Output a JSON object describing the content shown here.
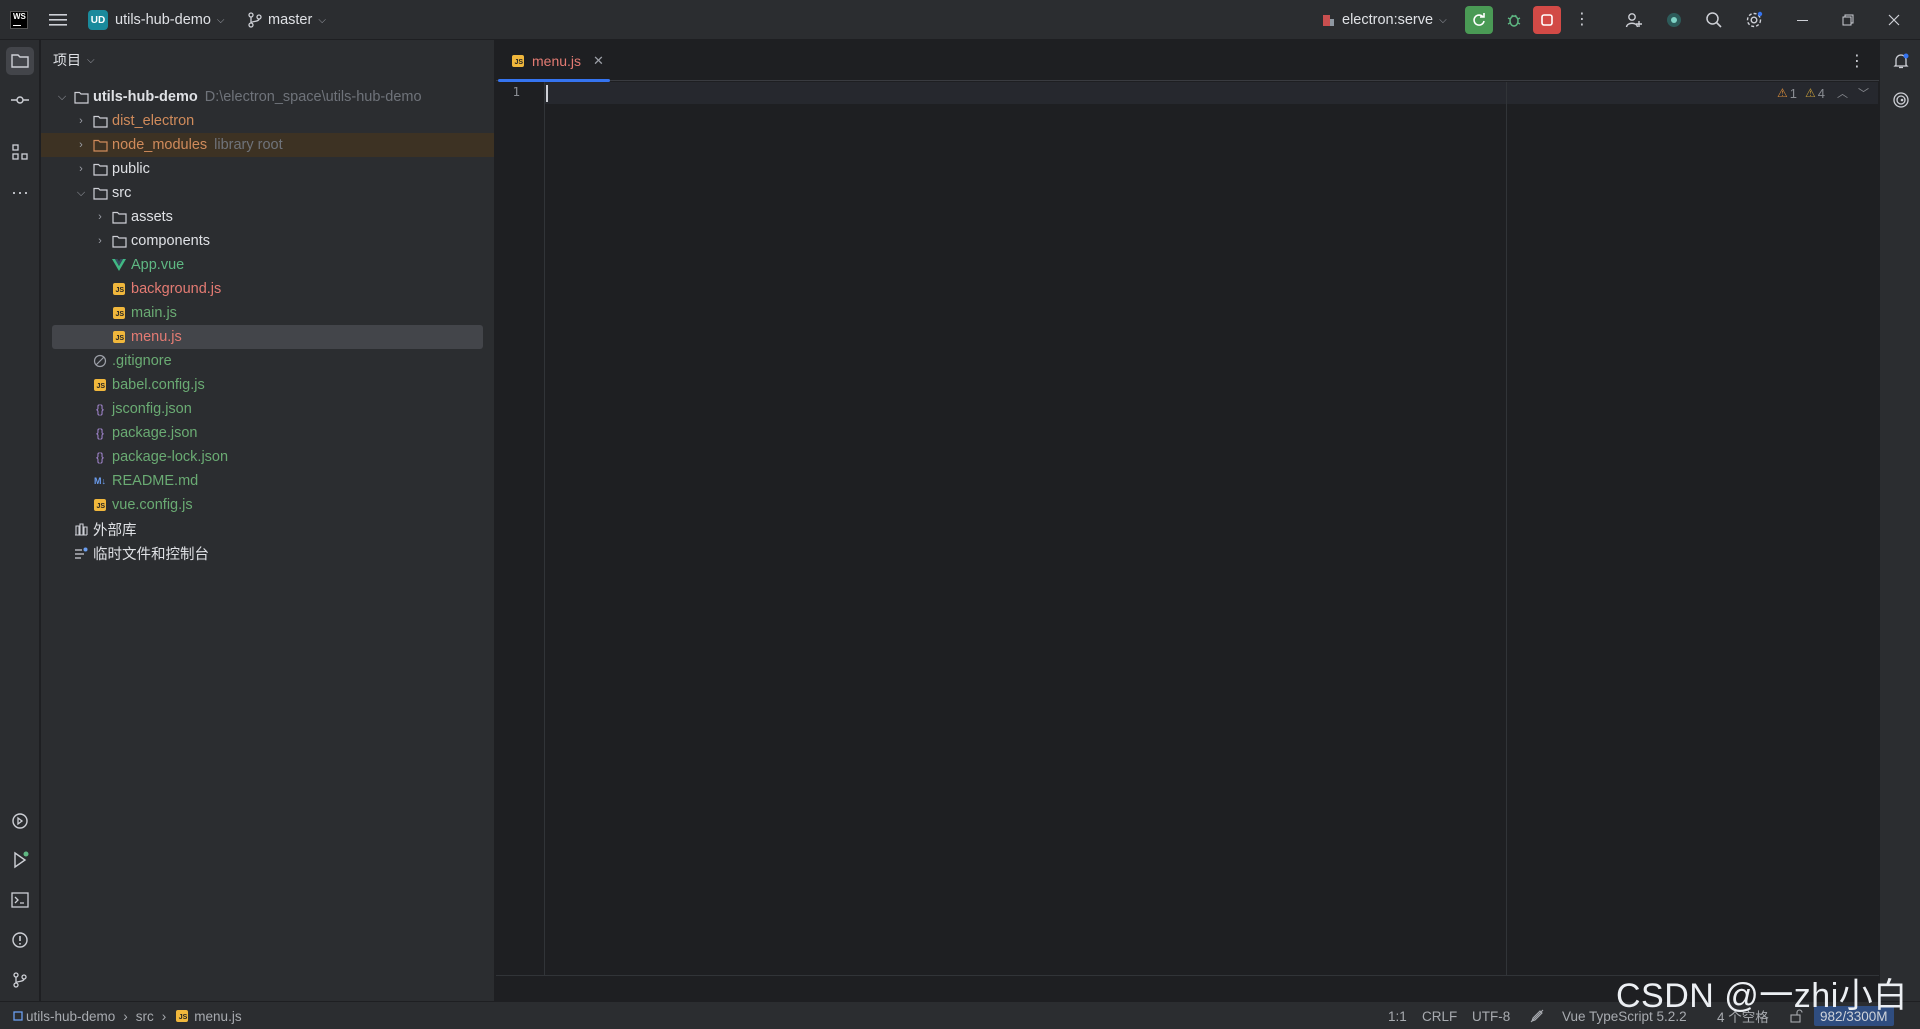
{
  "titlebar": {
    "project_badge": "UD",
    "project_name": "utils-hub-demo",
    "branch": "master",
    "run_config": "electron:serve"
  },
  "project_panel": {
    "header": "项目",
    "root": {
      "name": "utils-hub-demo",
      "path": "D:\\electron_space\\utils-hub-demo"
    },
    "items": [
      {
        "label": "dist_electron",
        "hint": "",
        "icon": "folder-icon"
      },
      {
        "label": "node_modules",
        "hint": "library root",
        "icon": "folder-icon"
      },
      {
        "label": "public",
        "hint": "",
        "icon": "folder-icon"
      },
      {
        "label": "src",
        "hint": "",
        "icon": "folder-icon"
      },
      {
        "label": "assets",
        "hint": "",
        "icon": "folder-icon"
      },
      {
        "label": "components",
        "hint": "",
        "icon": "folder-icon"
      },
      {
        "label": "App.vue",
        "hint": "",
        "icon": "vue-file-icon"
      },
      {
        "label": "background.js",
        "hint": "",
        "icon": "js-file-icon"
      },
      {
        "label": "main.js",
        "hint": "",
        "icon": "js-file-icon"
      },
      {
        "label": "menu.js",
        "hint": "",
        "icon": "js-file-icon"
      },
      {
        "label": ".gitignore",
        "hint": "",
        "icon": "ignore-file-icon"
      },
      {
        "label": "babel.config.js",
        "hint": "",
        "icon": "js-file-icon"
      },
      {
        "label": "jsconfig.json",
        "hint": "",
        "icon": "json-file-icon"
      },
      {
        "label": "package.json",
        "hint": "",
        "icon": "json-file-icon"
      },
      {
        "label": "package-lock.json",
        "hint": "",
        "icon": "json-file-icon"
      },
      {
        "label": "README.md",
        "hint": "",
        "icon": "markdown-file-icon"
      },
      {
        "label": "vue.config.js",
        "hint": "",
        "icon": "js-file-icon"
      },
      {
        "label": "外部库",
        "hint": "",
        "icon": "library-icon"
      },
      {
        "label": "临时文件和控制台",
        "hint": "",
        "icon": "scratches-icon"
      }
    ]
  },
  "editor": {
    "tab_label": "menu.js",
    "line_number": "1",
    "errors": "1",
    "warnings": "4"
  },
  "statusbar": {
    "breadcrumb": [
      "utils-hub-demo",
      "src",
      "menu.js"
    ],
    "position": "1:1",
    "line_sep": "CRLF",
    "encoding": "UTF-8",
    "language": "Vue TypeScript 5.2.2",
    "indent": "4 个空格",
    "memory": "982/3300M"
  },
  "watermark": "CSDN @一zhi小白",
  "colors": {
    "accent": "#3574f0",
    "run_green": "#4a9a55",
    "stop_red": "#d24a46"
  }
}
